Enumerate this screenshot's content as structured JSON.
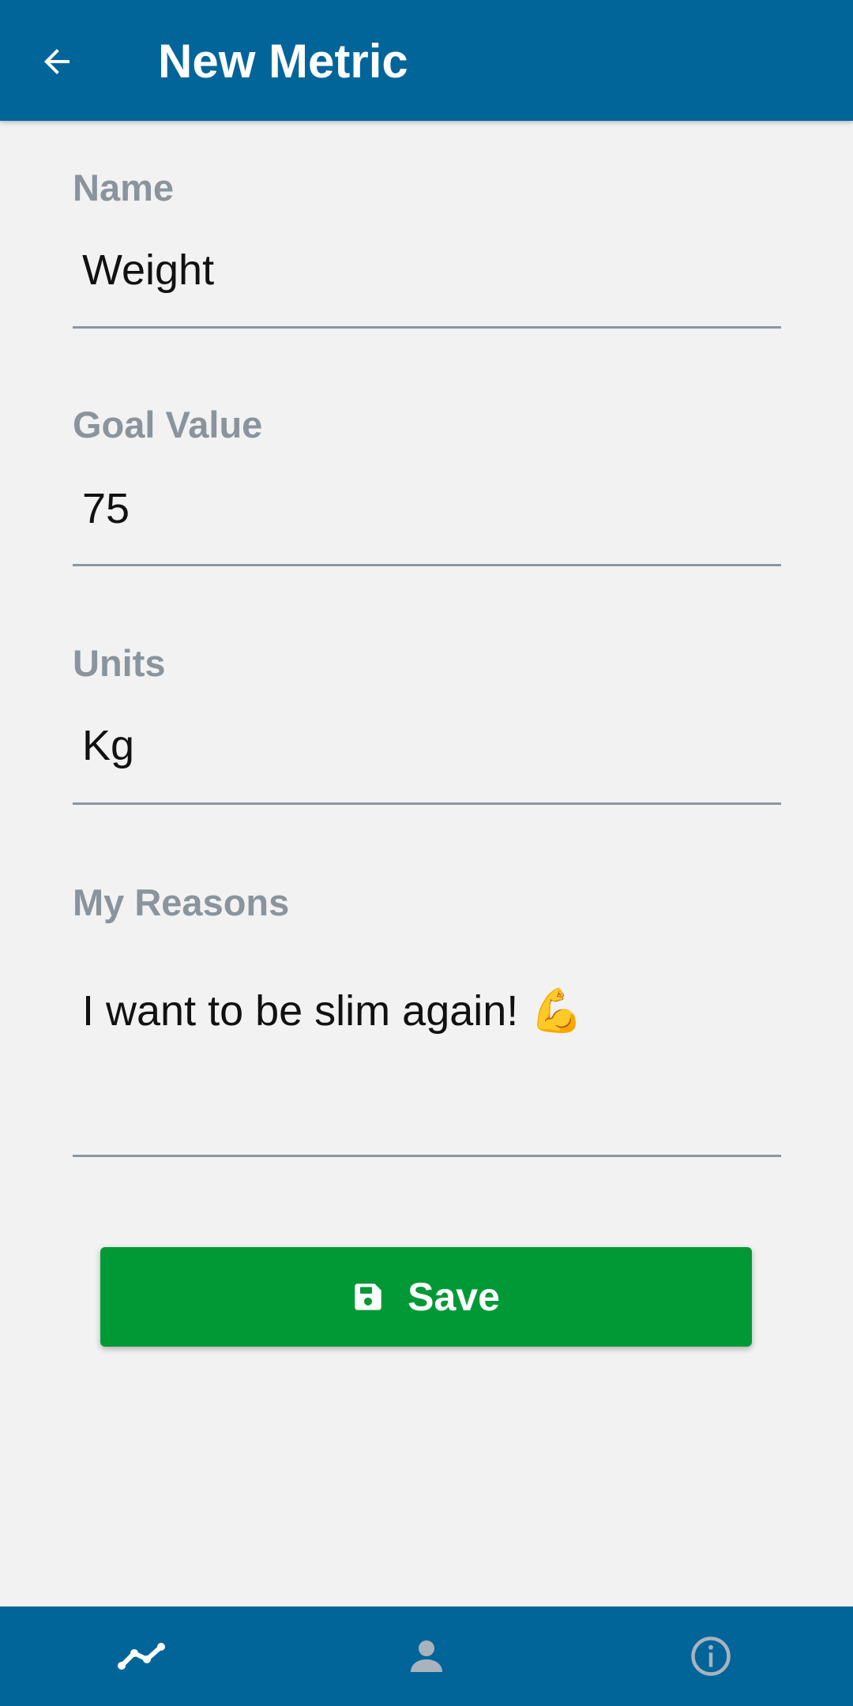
{
  "header": {
    "title": "New Metric",
    "back_icon": "arrow-left-icon"
  },
  "form": {
    "name": {
      "label": "Name",
      "value": "Weight"
    },
    "goal_value": {
      "label": "Goal Value",
      "value": "75"
    },
    "units": {
      "label": "Units",
      "value": "Kg"
    },
    "reasons": {
      "label": "My Reasons",
      "value": "I want to be slim again! 💪"
    }
  },
  "save_button": {
    "label": "Save",
    "icon": "floppy-disk-icon"
  },
  "bottom_nav": {
    "items": [
      {
        "icon": "chart-line-icon",
        "active": true
      },
      {
        "icon": "user-icon",
        "active": false
      },
      {
        "icon": "info-icon",
        "active": false
      }
    ]
  },
  "colors": {
    "primary": "#01659a",
    "save_green": "#019936",
    "label_gray": "#8a949d",
    "background": "#f2f2f2",
    "inactive_nav_icon": "#a9b3bd"
  }
}
